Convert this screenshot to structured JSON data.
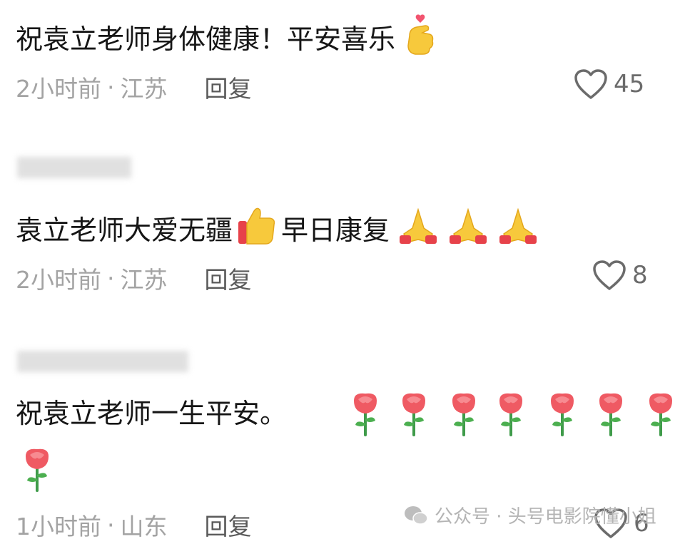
{
  "comments": [
    {
      "text_main": "祝袁立老师身体健康！平安喜乐",
      "time": "2小时前",
      "location": "江苏",
      "reply": "回复",
      "likes": "45"
    },
    {
      "text_a": "袁立老师大爱无疆",
      "text_b": "早日康复",
      "time": "2小时前",
      "location": "江苏",
      "reply": "回复",
      "likes": "8"
    },
    {
      "text_main": "祝袁立老师一生平安。",
      "time": "1小时前",
      "location": "山东",
      "reply": "回复",
      "likes": "6"
    }
  ],
  "separator": "·",
  "watermark": {
    "text": "公众号 · 头号电影院懂小姐"
  },
  "icons": {
    "heart": "heart-icon",
    "finger_heart": "finger-heart-emoji",
    "thumbs_up": "thumbs-up-emoji",
    "pray": "folded-hands-emoji",
    "rose": "rose-emoji",
    "wechat": "wechat-icon"
  }
}
